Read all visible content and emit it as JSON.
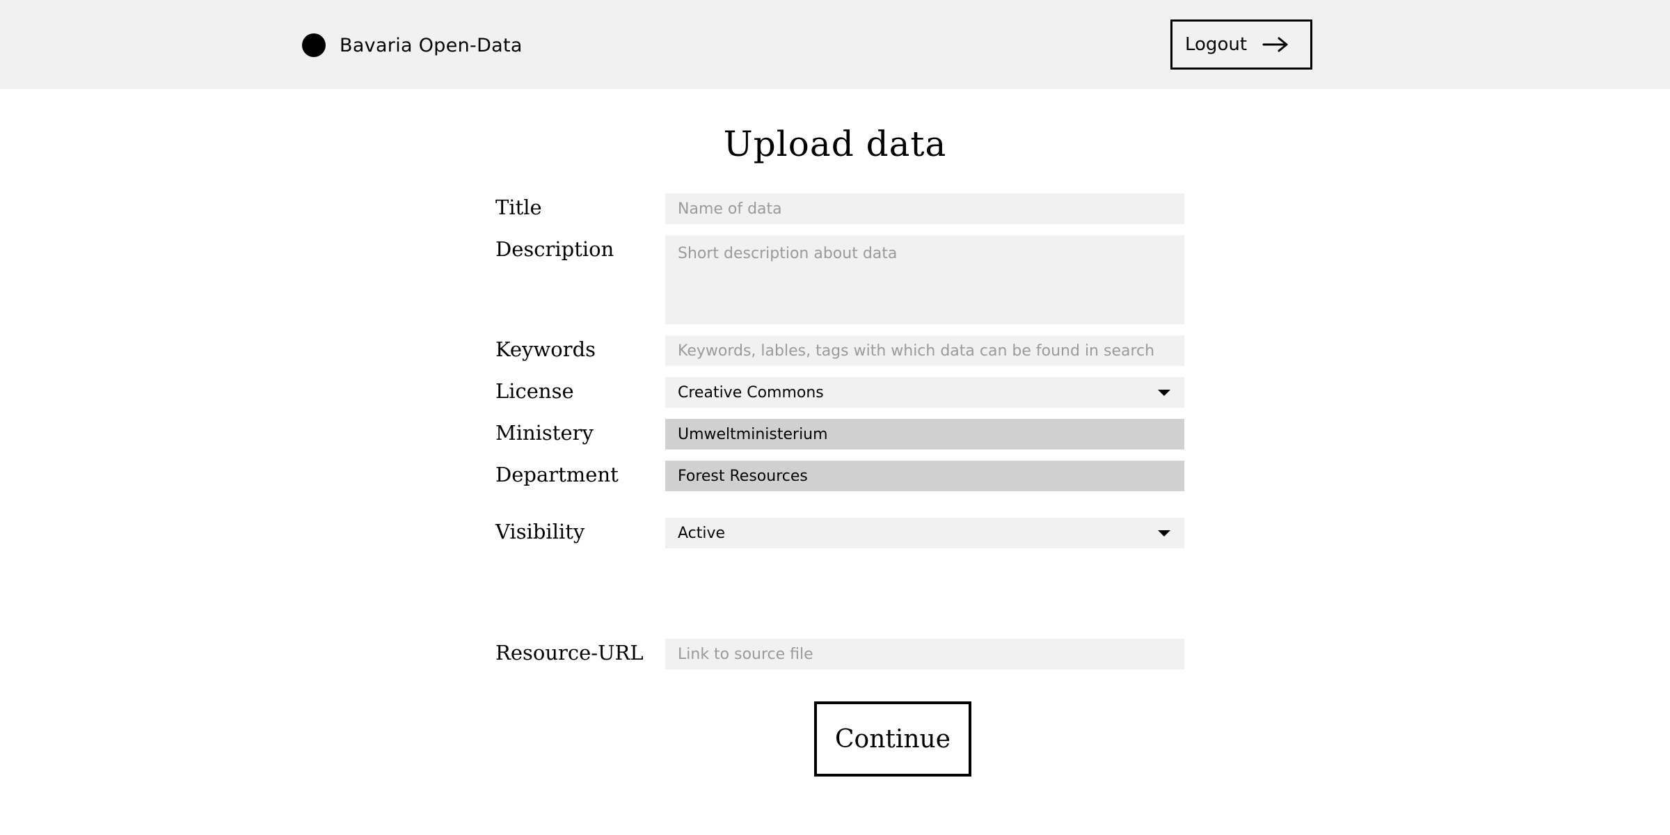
{
  "header": {
    "brand_name": "Bavaria Open-Data",
    "logout_label": "Logout"
  },
  "page": {
    "title": "Upload data"
  },
  "form": {
    "title": {
      "label": "Title",
      "placeholder": "Name of data",
      "value": ""
    },
    "description": {
      "label": "Description",
      "placeholder": "Short description about data",
      "value": ""
    },
    "keywords": {
      "label": "Keywords",
      "placeholder": "Keywords, lables, tags with which data can be found in search",
      "value": ""
    },
    "license": {
      "label": "License",
      "selected": "Creative Commons"
    },
    "ministry": {
      "label": "Ministery",
      "value": "Umweltministerium"
    },
    "department": {
      "label": "Department",
      "value": "Forest Resources"
    },
    "visibility": {
      "label": "Visibility",
      "selected": "Active"
    },
    "resource_url": {
      "label": "Resource-URL",
      "placeholder": "Link to source file",
      "value": ""
    },
    "continue_label": "Continue"
  },
  "colors": {
    "header_bg": "#f1f1f1",
    "input_bg": "#f1f1f1",
    "readonly_bg": "#d0d0d0",
    "placeholder": "#9a9a9a",
    "text": "#000000"
  },
  "icons": {
    "brand": "filled-circle-icon",
    "logout": "arrow-right-icon",
    "dropdown": "caret-down-icon"
  }
}
